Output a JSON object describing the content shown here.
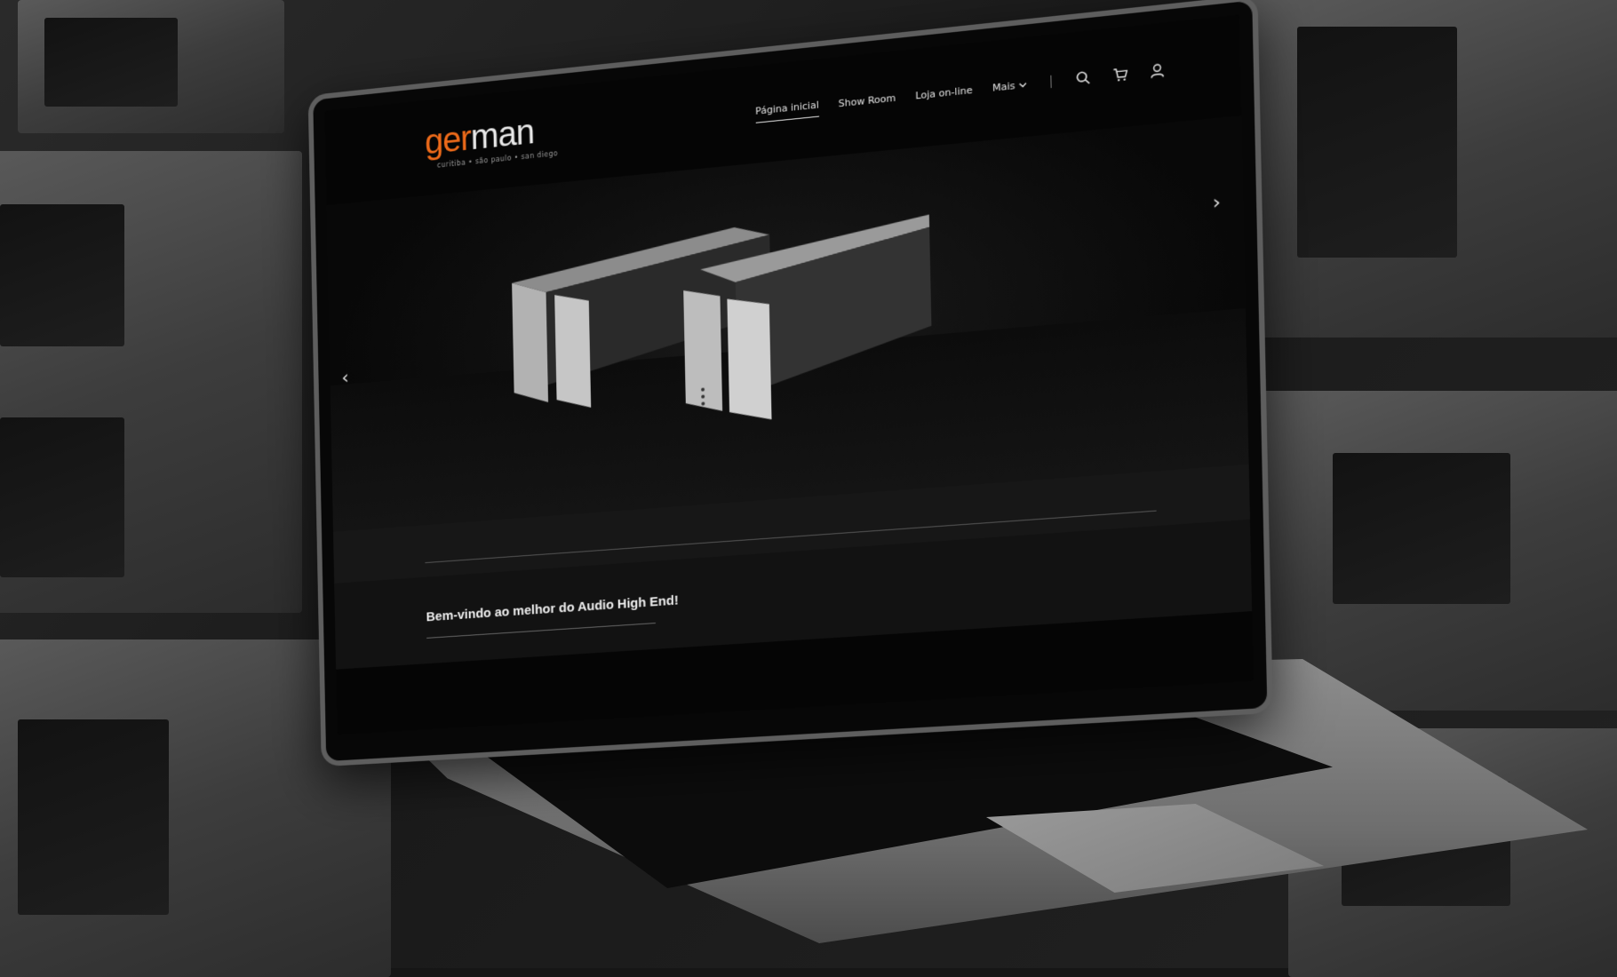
{
  "site": {
    "logo": {
      "brand_start": "ger",
      "brand_end": "man",
      "tagline": "curitiba • são paulo • san diego"
    },
    "nav": [
      {
        "label": "Página inicial",
        "active": true
      },
      {
        "label": "Show Room",
        "active": false
      },
      {
        "label": "Loja on-line",
        "active": false
      }
    ],
    "more_label": "Mais",
    "icons": [
      "search-icon",
      "cart-icon",
      "user-icon"
    ],
    "hero": {
      "prev_arrow": "‹",
      "next_arrow": "›"
    },
    "welcome_text": "Bem-vindo ao melhor do Audio High End!"
  },
  "colors": {
    "accent": "#ef6b1a",
    "background": "#050505",
    "text": "#e6e6e6"
  }
}
